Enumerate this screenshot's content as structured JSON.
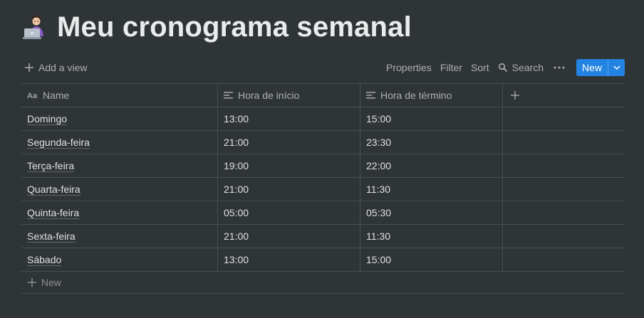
{
  "page": {
    "title": "Meu cronograma semanal",
    "icon": "woman-technologist-emoji"
  },
  "toolbar": {
    "add_view": "Add a view",
    "properties": "Properties",
    "filter": "Filter",
    "sort": "Sort",
    "search": "Search",
    "new": "New",
    "accent": "#2383e2"
  },
  "table": {
    "columns": [
      {
        "label": "Name",
        "icon": "title-aa-icon"
      },
      {
        "label": "Hora de início",
        "icon": "text-lines-icon"
      },
      {
        "label": "Hora de término",
        "icon": "text-lines-icon"
      }
    ],
    "rows": [
      {
        "name": "Domingo",
        "start": "13:00",
        "end": "15:00"
      },
      {
        "name": "Segunda-feira",
        "start": "21:00",
        "end": "23:30"
      },
      {
        "name": "Terça-feira",
        "start": "19:00",
        "end": "22:00"
      },
      {
        "name": "Quarta-feira",
        "start": "21:00",
        "end": "11:30"
      },
      {
        "name": "Quinta-feira",
        "start": "05:00",
        "end": "05:30"
      },
      {
        "name": "Sexta-feira",
        "start": "21:00",
        "end": "11:30"
      },
      {
        "name": "Sábado",
        "start": "13:00",
        "end": "15:00"
      }
    ],
    "add_row_label": "New"
  }
}
